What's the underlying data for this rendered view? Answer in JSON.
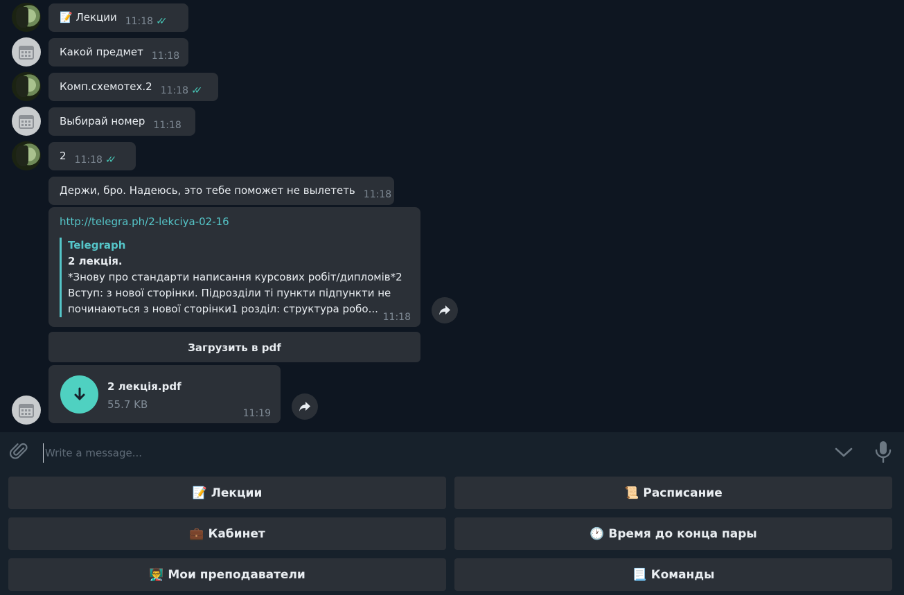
{
  "messages": [
    {
      "text": "📝 Лекции",
      "time": "11:18",
      "read": "✓✓"
    },
    {
      "text": "Какой предмет",
      "time": "11:18"
    },
    {
      "text": "Комп.схемотех.2",
      "time": "11:18",
      "read": "✓✓"
    },
    {
      "text": "Выбирай номер",
      "time": "11:18"
    },
    {
      "text": "2",
      "time": "11:18",
      "read": "✓✓"
    },
    {
      "text": "Держи, бро. Надеюсь, это тебе поможет не вылететь",
      "time": "11:18"
    }
  ],
  "link_message": {
    "url": "http://telegra.ph/2-lekciya-02-16",
    "site": "Telegraph",
    "title": "2 лекція.",
    "line1": "*Знову про стандарти написання курсових робіт/дипломів*2",
    "line2": "Вступ: з нової сторінки. Підрозділи ті пункти підпункти не",
    "line3": "починаються з нової сторінки1 розділ: структура робо...",
    "time": "11:18"
  },
  "inline_button": "Загрузить в pdf",
  "file": {
    "name": "2 лекція.pdf",
    "size": "55.7 KB",
    "time": "11:19"
  },
  "composer": {
    "placeholder": "Write a message..."
  },
  "keyboard": [
    {
      "emoji": "📝",
      "label": "Лекции"
    },
    {
      "emoji": "📜",
      "label": "Расписание"
    },
    {
      "emoji": "💼",
      "label": "Кабинет"
    },
    {
      "emoji": "🕐",
      "label": "Время до конца пары"
    },
    {
      "emoji": "👨‍🏫",
      "label": "Мои преподаватели"
    },
    {
      "emoji": "📃",
      "label": "Команды"
    }
  ],
  "colors": {
    "accent": "#4fd1c1",
    "link": "#55c5c8",
    "bubble": "#2b3037",
    "bg": "#0e1621"
  }
}
